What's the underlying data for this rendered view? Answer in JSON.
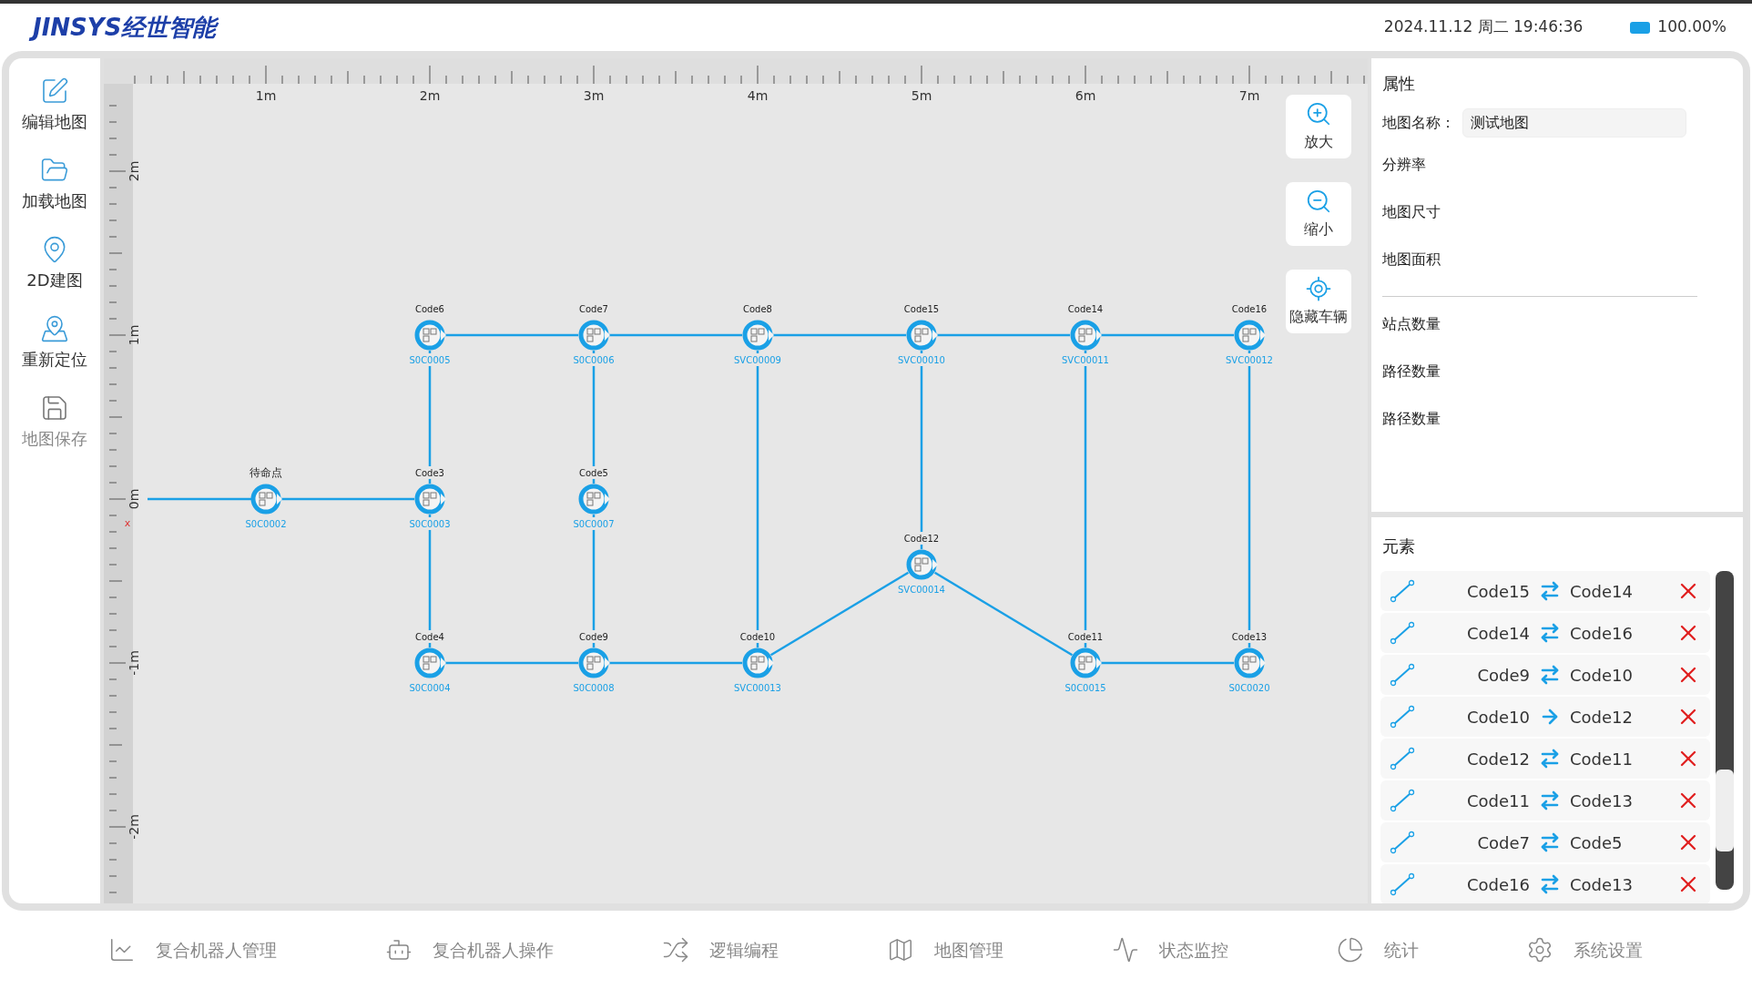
{
  "header": {
    "logo": "JINSYS经世智能",
    "datetime": "2024.11.12 周二 19:46:36",
    "battery": "100.00%"
  },
  "sidebar": {
    "items": [
      {
        "label": "编辑地图",
        "disabled": false
      },
      {
        "label": "加载地图",
        "disabled": false
      },
      {
        "label": "2D建图",
        "disabled": false
      },
      {
        "label": "重新定位",
        "disabled": false
      },
      {
        "label": "地图保存",
        "disabled": true
      }
    ]
  },
  "map": {
    "x_ruler": [
      "1m",
      "2m",
      "3m",
      "4m",
      "5m",
      "6m",
      "7m"
    ],
    "y_ruler": [
      "2m",
      "1m",
      "0m",
      "-1m",
      "-2m"
    ],
    "axis_mark": "x",
    "nodes": [
      {
        "code": "Code6",
        "station": "S0C0005"
      },
      {
        "code": "Code7",
        "station": "S0C0006"
      },
      {
        "code": "Code8",
        "station": "SVC00009"
      },
      {
        "code": "Code15",
        "station": "SVC00010"
      },
      {
        "code": "Code14",
        "station": "SVC00011"
      },
      {
        "code": "Code16",
        "station": "SVC00012"
      },
      {
        "code": "待命点",
        "station": "S0C0002"
      },
      {
        "code": "Code3",
        "station": "S0C0003"
      },
      {
        "code": "Code5",
        "station": "S0C0007"
      },
      {
        "code": "Code12",
        "station": "SVC00014"
      },
      {
        "code": "Code4",
        "station": "S0C0004"
      },
      {
        "code": "Code9",
        "station": "S0C0008"
      },
      {
        "code": "Code10",
        "station": "SVC00013"
      },
      {
        "code": "Code11",
        "station": "S0C0015"
      },
      {
        "code": "Code13",
        "station": "S0C0020"
      }
    ],
    "tools": [
      "放大",
      "缩小",
      "隐藏车辆"
    ]
  },
  "properties": {
    "title": "属性",
    "map_name_label": "地图名称：",
    "map_name_value": "测试地图",
    "rows_a": [
      "分辨率",
      "地图尺寸",
      "地图面积"
    ],
    "rows_b": [
      "站点数量",
      "路径数量",
      "路径数量"
    ]
  },
  "elements": {
    "title": "元素",
    "routes": [
      {
        "from": "Code15",
        "to": "Code14",
        "kind": "two_way"
      },
      {
        "from": "Code14",
        "to": "Code16",
        "kind": "two_way"
      },
      {
        "from": "Code9",
        "to": "Code10",
        "kind": "two_way"
      },
      {
        "from": "Code10",
        "to": "Code12",
        "kind": "one_way"
      },
      {
        "from": "Code12",
        "to": "Code11",
        "kind": "two_way"
      },
      {
        "from": "Code11",
        "to": "Code13",
        "kind": "two_way"
      },
      {
        "from": "Code7",
        "to": "Code5",
        "kind": "two_way"
      },
      {
        "from": "Code16",
        "to": "Code13",
        "kind": "two_way"
      }
    ]
  },
  "bottom_nav": [
    "复合机器人管理",
    "复合机器人操作",
    "逻辑编程",
    "地图管理",
    "状态监控",
    "统计",
    "系统设置"
  ]
}
